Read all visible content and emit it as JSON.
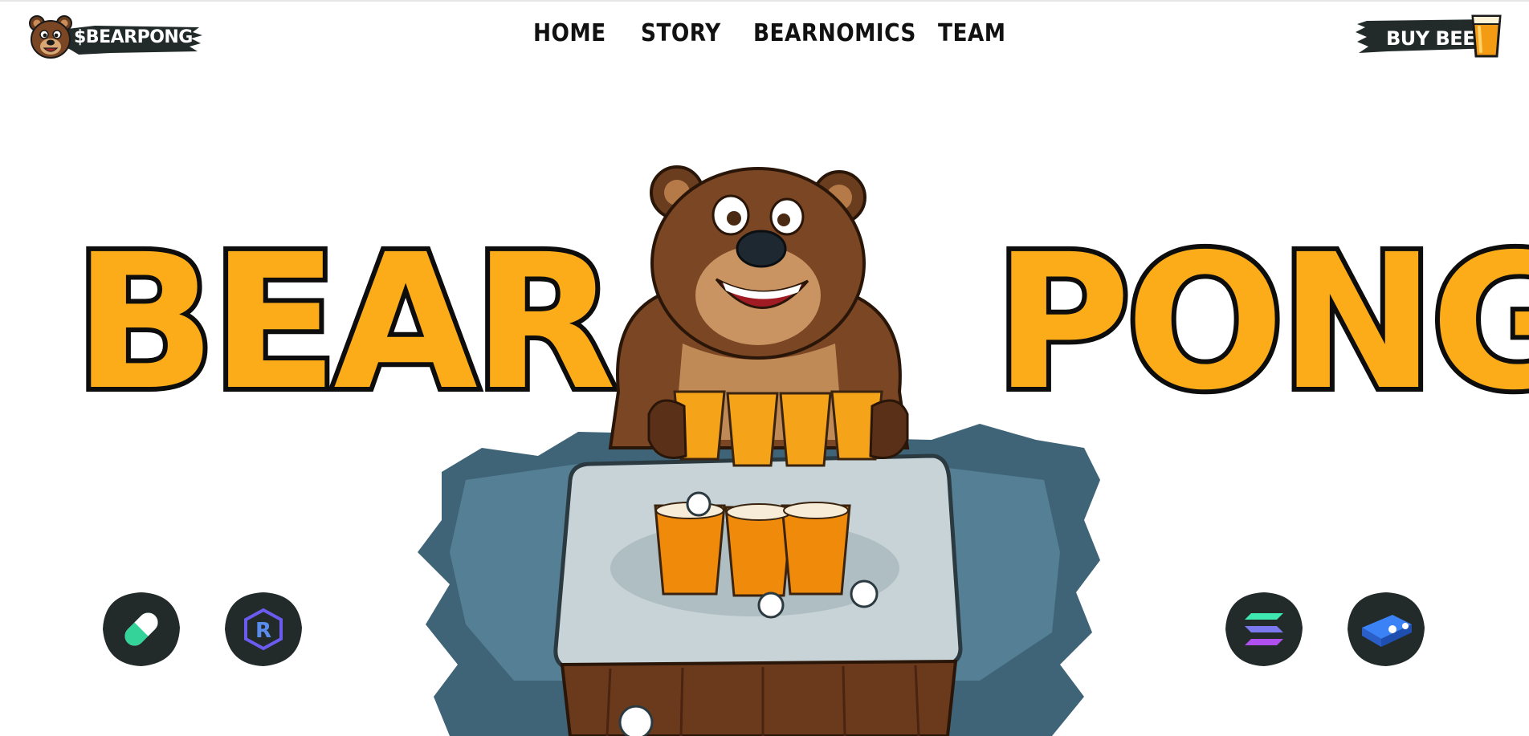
{
  "brand": {
    "logo_text": "$BEARPONG"
  },
  "nav": {
    "items": [
      {
        "label": "HOME"
      },
      {
        "label": "STORY"
      },
      {
        "label": "BEARNOMICS"
      },
      {
        "label": "TEAM"
      }
    ]
  },
  "cta": {
    "buy_label": "BUY BEER"
  },
  "hero": {
    "title_left": "BEAR",
    "title_right": "PONG"
  },
  "colors": {
    "accent_orange": "#fbac18",
    "ink": "#0d0d0d",
    "brush_dark": "#222a2a",
    "social_green": "#34d39a",
    "social_purple": "#6b5cf0",
    "social_blue": "#3b82f6"
  },
  "social_links": [
    {
      "icon": "pill-icon"
    },
    {
      "icon": "raydium-icon"
    },
    {
      "icon": "solana-icon"
    },
    {
      "icon": "dexscreener-icon"
    }
  ]
}
